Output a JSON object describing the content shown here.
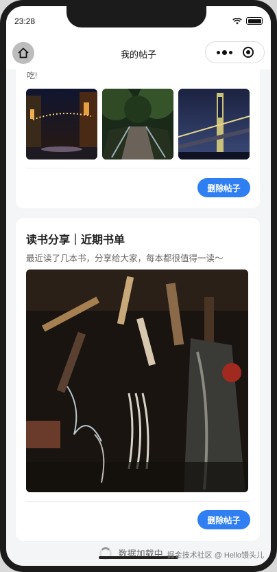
{
  "status": {
    "time": "23:28"
  },
  "navbar": {
    "title": "我的帖子"
  },
  "posts": [
    {
      "text_truncated": "吃!",
      "delete_label": "删除帖子"
    },
    {
      "title": "读书分享｜近期书单",
      "subtitle": "最近读了几本书，分享给大家，每本都很值得一读～",
      "delete_label": "删除帖子"
    }
  ],
  "loading": {
    "text": "数据加载中......"
  },
  "watermark": "掘金技术社区 @ Hello馒头儿",
  "colors": {
    "accent": "#2f7ff2",
    "page_bg": "#f4f5f7"
  }
}
